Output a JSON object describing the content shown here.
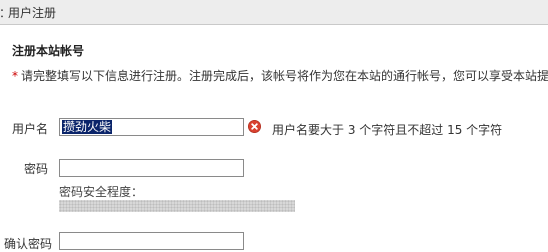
{
  "header": {
    "separator": "：",
    "title": "用户注册"
  },
  "section": {
    "title": "注册本站帐号"
  },
  "notice": {
    "star": "*",
    "text": "请完整填写以下信息进行注册。注册完成后，该帐号将作为您在本站的通行帐号，您可以享受本站提"
  },
  "form": {
    "username": {
      "label": "用户名",
      "value": "攒劲火柴",
      "error_message": "用户名要大于 3 个字符且不超过 15 个字符"
    },
    "password": {
      "label": "密码",
      "value": "",
      "strength_label": "密码安全程度："
    },
    "confirm_password": {
      "label": "确认密码",
      "value": ""
    }
  },
  "colors": {
    "error_icon": "#d9412f",
    "required_star": "#cc0000",
    "selection": "#0a246a"
  },
  "icons": {
    "error": "error-x-icon"
  }
}
